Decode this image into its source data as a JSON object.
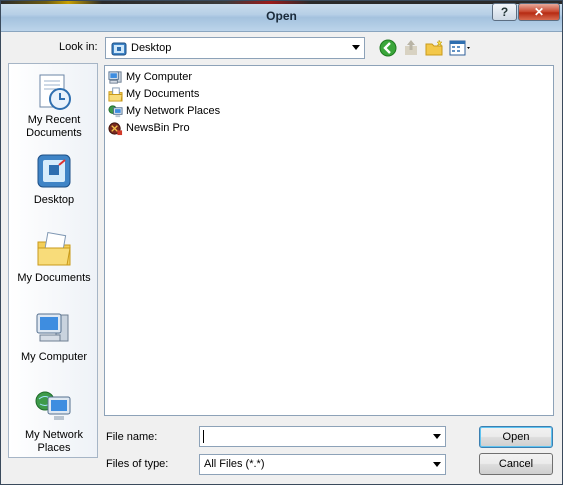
{
  "window": {
    "title": "Open",
    "help_label": "?",
    "close_label": "✕"
  },
  "look_in": {
    "label": "Look in:",
    "value": "Desktop",
    "icon": "desktop-icon"
  },
  "toolbar": {
    "items": [
      "back-icon",
      "up-folder-icon",
      "new-folder-icon",
      "view-menu-icon"
    ]
  },
  "places_bar": {
    "items": [
      {
        "label_line1": "My Recent",
        "label_line2": "Documents",
        "icon": "recent-documents-icon"
      },
      {
        "label_line1": "Desktop",
        "label_line2": "",
        "icon": "desktop-icon"
      },
      {
        "label_line1": "My Documents",
        "label_line2": "",
        "icon": "my-documents-icon"
      },
      {
        "label_line1": "My Computer",
        "label_line2": "",
        "icon": "my-computer-icon"
      },
      {
        "label_line1": "My Network",
        "label_line2": "Places",
        "icon": "network-places-icon"
      }
    ]
  },
  "files": [
    {
      "label": "My Computer",
      "icon": "my-computer-icon"
    },
    {
      "label": "My Documents",
      "icon": "my-documents-icon"
    },
    {
      "label": "My Network Places",
      "icon": "network-places-icon"
    },
    {
      "label": "NewsBin Pro",
      "icon": "newsbin-icon"
    }
  ],
  "file_name": {
    "label": "File name:",
    "value": ""
  },
  "file_type": {
    "label": "Files of type:",
    "value": "All Files (*.*)"
  },
  "buttons": {
    "open": "Open",
    "cancel": "Cancel"
  },
  "colors": {
    "accent": "#3c7fb1",
    "titlebar": "#b6cfe6",
    "close": "#c7442b"
  }
}
